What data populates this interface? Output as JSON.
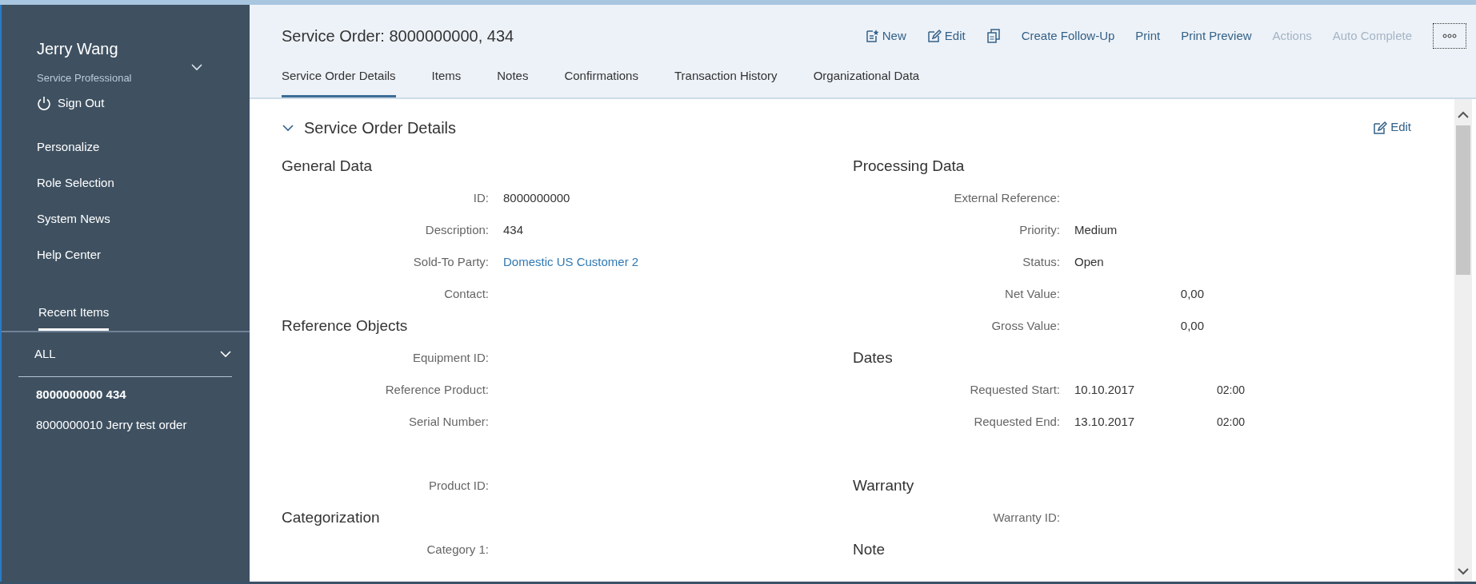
{
  "user": {
    "name": "Jerry Wang",
    "role": "Service Professional",
    "sign_out": "Sign Out"
  },
  "menu": [
    "Personalize",
    "Role Selection",
    "System News",
    "Help Center"
  ],
  "recent": {
    "tab": "Recent Items",
    "filter": "ALL",
    "items": [
      {
        "label": "8000000000 434",
        "selected": true
      },
      {
        "label": "8000000010 Jerry test order",
        "selected": false
      }
    ]
  },
  "title": "Service Order: 8000000000, 434",
  "toolbar": [
    {
      "kind": "new",
      "label": "New",
      "disabled": false
    },
    {
      "kind": "edit",
      "label": "Edit",
      "disabled": false
    },
    {
      "kind": "copy",
      "disabled": false
    },
    {
      "kind": "text",
      "label": "Create Follow-Up",
      "disabled": false
    },
    {
      "kind": "text",
      "label": "Print",
      "disabled": false
    },
    {
      "kind": "text",
      "label": "Print Preview",
      "disabled": false
    },
    {
      "kind": "text",
      "label": "Actions",
      "disabled": true
    },
    {
      "kind": "text",
      "label": "Auto Complete",
      "disabled": true
    },
    {
      "kind": "more",
      "disabled": false
    }
  ],
  "tabs": [
    {
      "label": "Service Order Details",
      "selected": true
    },
    {
      "label": "Items",
      "selected": false
    },
    {
      "label": "Notes",
      "selected": false
    },
    {
      "label": "Confirmations",
      "selected": false
    },
    {
      "label": "Transaction History",
      "selected": false
    },
    {
      "label": "Organizational Data",
      "selected": false
    }
  ],
  "section": {
    "title": "Service Order Details",
    "expanded": true,
    "edit": "Edit"
  },
  "columns": [
    [
      {
        "kind": "heading",
        "text": "General Data"
      },
      {
        "kind": "field",
        "label": "ID:",
        "value": "8000000000"
      },
      {
        "kind": "field",
        "label": "Description:",
        "value": "434"
      },
      {
        "kind": "link",
        "label": "Sold-To Party:",
        "value": "Domestic US Customer 2"
      },
      {
        "kind": "field",
        "label": "Contact:"
      },
      {
        "kind": "heading",
        "text": "Reference Objects"
      },
      {
        "kind": "field",
        "label": "Equipment ID:"
      },
      {
        "kind": "field",
        "label": "Reference Product:"
      },
      {
        "kind": "field",
        "label": "Serial Number:"
      },
      {
        "kind": "spacer"
      },
      {
        "kind": "field",
        "label": "Product ID:"
      },
      {
        "kind": "heading",
        "text": "Categorization"
      },
      {
        "kind": "field",
        "label": "Category 1:"
      }
    ],
    [
      {
        "kind": "heading",
        "text": "Processing Data"
      },
      {
        "kind": "field",
        "label": "External Reference:"
      },
      {
        "kind": "field",
        "label": "Priority:",
        "value": "Medium"
      },
      {
        "kind": "field",
        "label": "Status:",
        "value": "Open"
      },
      {
        "kind": "amount",
        "label": "Net Value:",
        "value": "0,00"
      },
      {
        "kind": "amount",
        "label": "Gross Value:",
        "value": "0,00"
      },
      {
        "kind": "heading",
        "text": "Dates"
      },
      {
        "kind": "datetime",
        "label": "Requested Start:",
        "value": "10.10.2017",
        "time": "02:00"
      },
      {
        "kind": "datetime",
        "label": "Requested End:",
        "value": "13.10.2017",
        "time": "02:00"
      },
      {
        "kind": "spacer"
      },
      {
        "kind": "heading",
        "text": "Warranty"
      },
      {
        "kind": "field",
        "label": "Warranty ID:"
      },
      {
        "kind": "heading",
        "text": "Note"
      }
    ]
  ]
}
